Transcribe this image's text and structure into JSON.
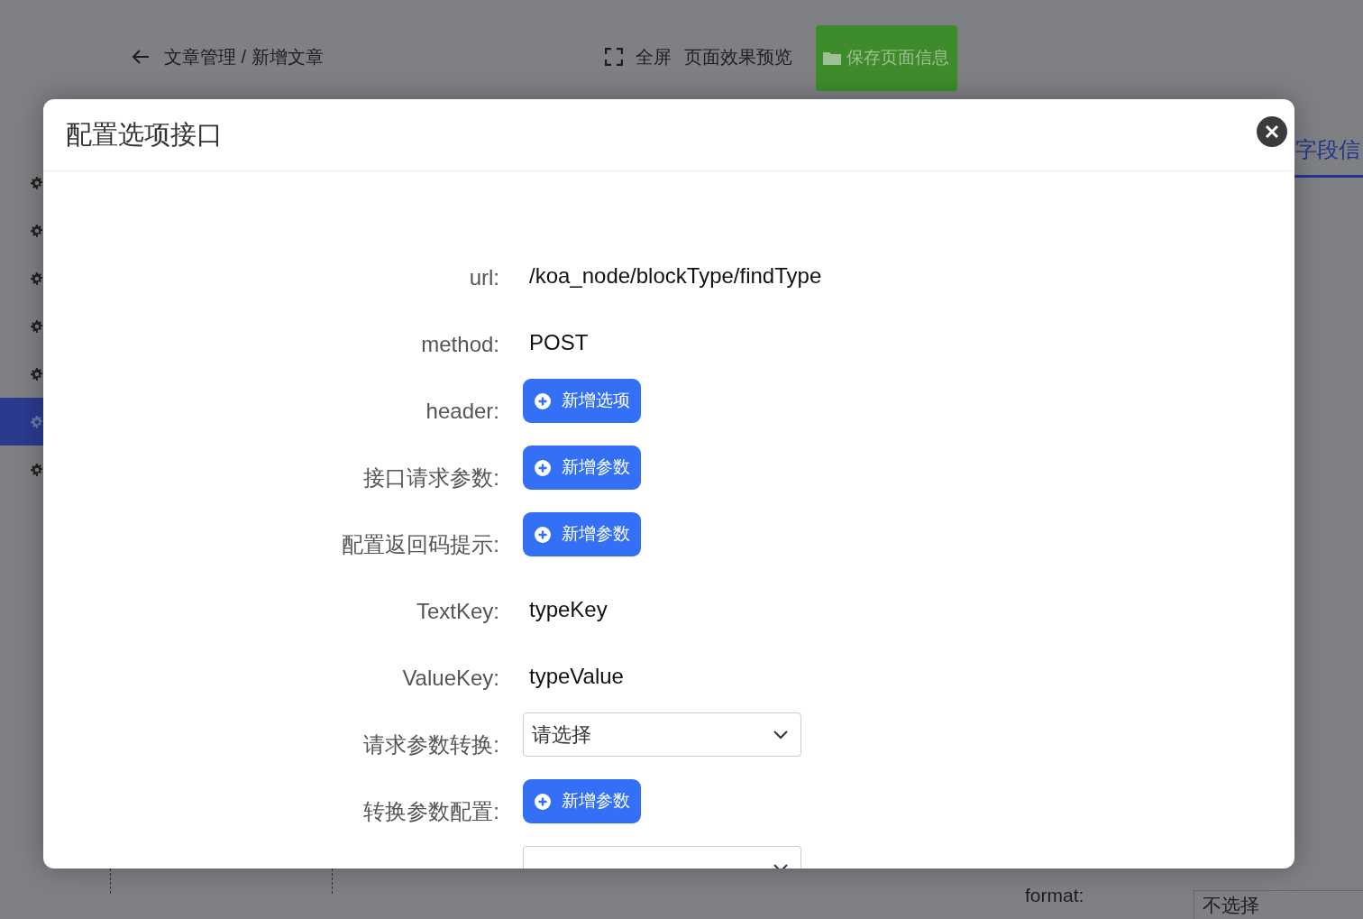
{
  "page": {
    "breadcrumb": "文章管理 / 新增文章",
    "fullscreen": "全屏",
    "preview": "页面效果预览",
    "save": "保存页面信息",
    "side_items": [
      {
        "selected": false
      },
      {
        "selected": false
      },
      {
        "selected": false
      },
      {
        "selected": false
      },
      {
        "selected": false
      },
      {
        "selected": true
      },
      {
        "selected": false
      }
    ],
    "tab": "字段信",
    "format_label": "format:",
    "format_value": "不选择"
  },
  "dialog": {
    "title": "配置选项接口",
    "rows": [
      {
        "label": "url:",
        "kind": "text",
        "value": "/koa_node/blockType/findType"
      },
      {
        "label": "method:",
        "kind": "text",
        "value": "POST"
      },
      {
        "label": "header:",
        "kind": "button",
        "button": "新增选项"
      },
      {
        "label": "接口请求参数:",
        "kind": "button",
        "button": "新增参数"
      },
      {
        "label": "配置返回码提示:",
        "kind": "button",
        "button": "新增参数"
      },
      {
        "label": "TextKey:",
        "kind": "text",
        "value": "typeKey"
      },
      {
        "label": "ValueKey:",
        "kind": "text",
        "value": "typeValue"
      },
      {
        "label": "请求参数转换:",
        "kind": "select",
        "placeholder": "请选择"
      },
      {
        "label": "转换参数配置:",
        "kind": "button",
        "button": "新增参数"
      },
      {
        "kind": "select"
      }
    ]
  }
}
